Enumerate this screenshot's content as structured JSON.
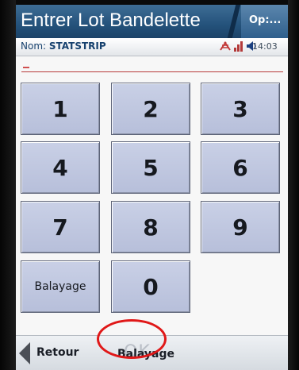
{
  "titlebar": {
    "title": "Entrer Lot Bandelette",
    "menu_label": "Op:..."
  },
  "statusbar": {
    "name_label": "Nom:",
    "name_value": "STATSTRIP",
    "time": "14:03",
    "icons": [
      "connectivity-icon",
      "signal-icon",
      "speaker-icon"
    ]
  },
  "lot_input": {
    "value": ""
  },
  "keypad": {
    "keys": [
      "1",
      "2",
      "3",
      "4",
      "5",
      "6",
      "7",
      "8",
      "9",
      "Balayage",
      "0"
    ]
  },
  "footer": {
    "back_label": "Retour",
    "ok_label": "OK",
    "scan_label": "Balayage"
  },
  "colors": {
    "titlebar": "#24527b",
    "key_face": "#bfc6e0",
    "highlight_ring": "#e01818"
  }
}
